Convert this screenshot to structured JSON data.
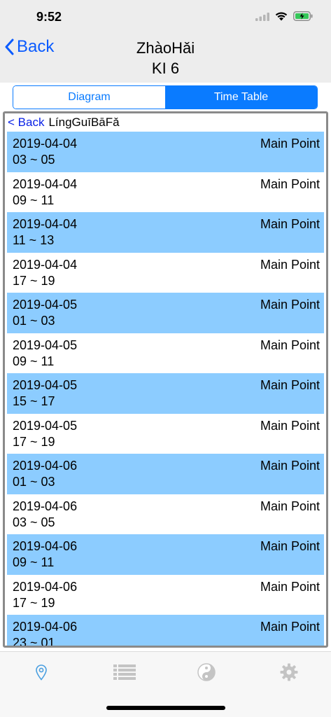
{
  "status": {
    "time": "9:52"
  },
  "nav": {
    "back_label": "Back",
    "title_line1": "ZhàoHǎi",
    "title_line2": "KI 6"
  },
  "segments": [
    {
      "label": "Diagram",
      "active": false
    },
    {
      "label": "Time Table",
      "active": true
    }
  ],
  "subheader": {
    "back_label": "< Back",
    "title": "LíngGuīBāFǎ"
  },
  "rows": [
    {
      "date": "2019-04-04",
      "time": "03 ~ 05",
      "point": "Main Point"
    },
    {
      "date": "2019-04-04",
      "time": "09 ~ 11",
      "point": "Main Point"
    },
    {
      "date": "2019-04-04",
      "time": "11 ~ 13",
      "point": "Main Point"
    },
    {
      "date": "2019-04-04",
      "time": "17 ~ 19",
      "point": "Main Point"
    },
    {
      "date": "2019-04-05",
      "time": "01 ~ 03",
      "point": "Main Point"
    },
    {
      "date": "2019-04-05",
      "time": "09 ~ 11",
      "point": "Main Point"
    },
    {
      "date": "2019-04-05",
      "time": "15 ~ 17",
      "point": "Main Point"
    },
    {
      "date": "2019-04-05",
      "time": "17 ~ 19",
      "point": "Main Point"
    },
    {
      "date": "2019-04-06",
      "time": "01 ~ 03",
      "point": "Main Point"
    },
    {
      "date": "2019-04-06",
      "time": "03 ~ 05",
      "point": "Main Point"
    },
    {
      "date": "2019-04-06",
      "time": "09 ~ 11",
      "point": "Main Point"
    },
    {
      "date": "2019-04-06",
      "time": "17 ~ 19",
      "point": "Main Point"
    },
    {
      "date": "2019-04-06",
      "time": "23 ~ 01",
      "point": "Main Point"
    }
  ],
  "colors": {
    "accent": "#0a7bff",
    "row_shade": "#8cccff",
    "tab_active": "#4a9fe0",
    "tab_inactive": "#c4c4c4"
  },
  "tabs": [
    {
      "icon": "location-pin-icon",
      "active": true
    },
    {
      "icon": "list-icon",
      "active": false
    },
    {
      "icon": "yin-yang-icon",
      "active": false
    },
    {
      "icon": "gear-icon",
      "active": false
    }
  ]
}
